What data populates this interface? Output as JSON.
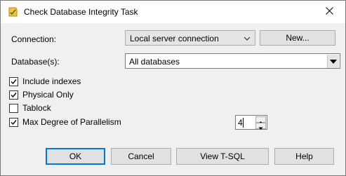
{
  "window": {
    "title": "Check Database Integrity Task"
  },
  "connection": {
    "label": "Connection:",
    "value": "Local server connection",
    "new_button": "New..."
  },
  "databases": {
    "label": "Database(s):",
    "value": "All databases"
  },
  "options": [
    {
      "label": "Include indexes",
      "checked": true
    },
    {
      "label": "Physical Only",
      "checked": true
    },
    {
      "label": "Tablock",
      "checked": false
    },
    {
      "label": "Max Degree of Parallelism",
      "checked": true
    }
  ],
  "parallelism": {
    "value": "4"
  },
  "buttons": {
    "ok": "OK",
    "cancel": "Cancel",
    "view_tsql": "View T-SQL",
    "help": "Help"
  },
  "colors": {
    "focus_border": "#0078d7",
    "background": "#f0f0f0"
  }
}
